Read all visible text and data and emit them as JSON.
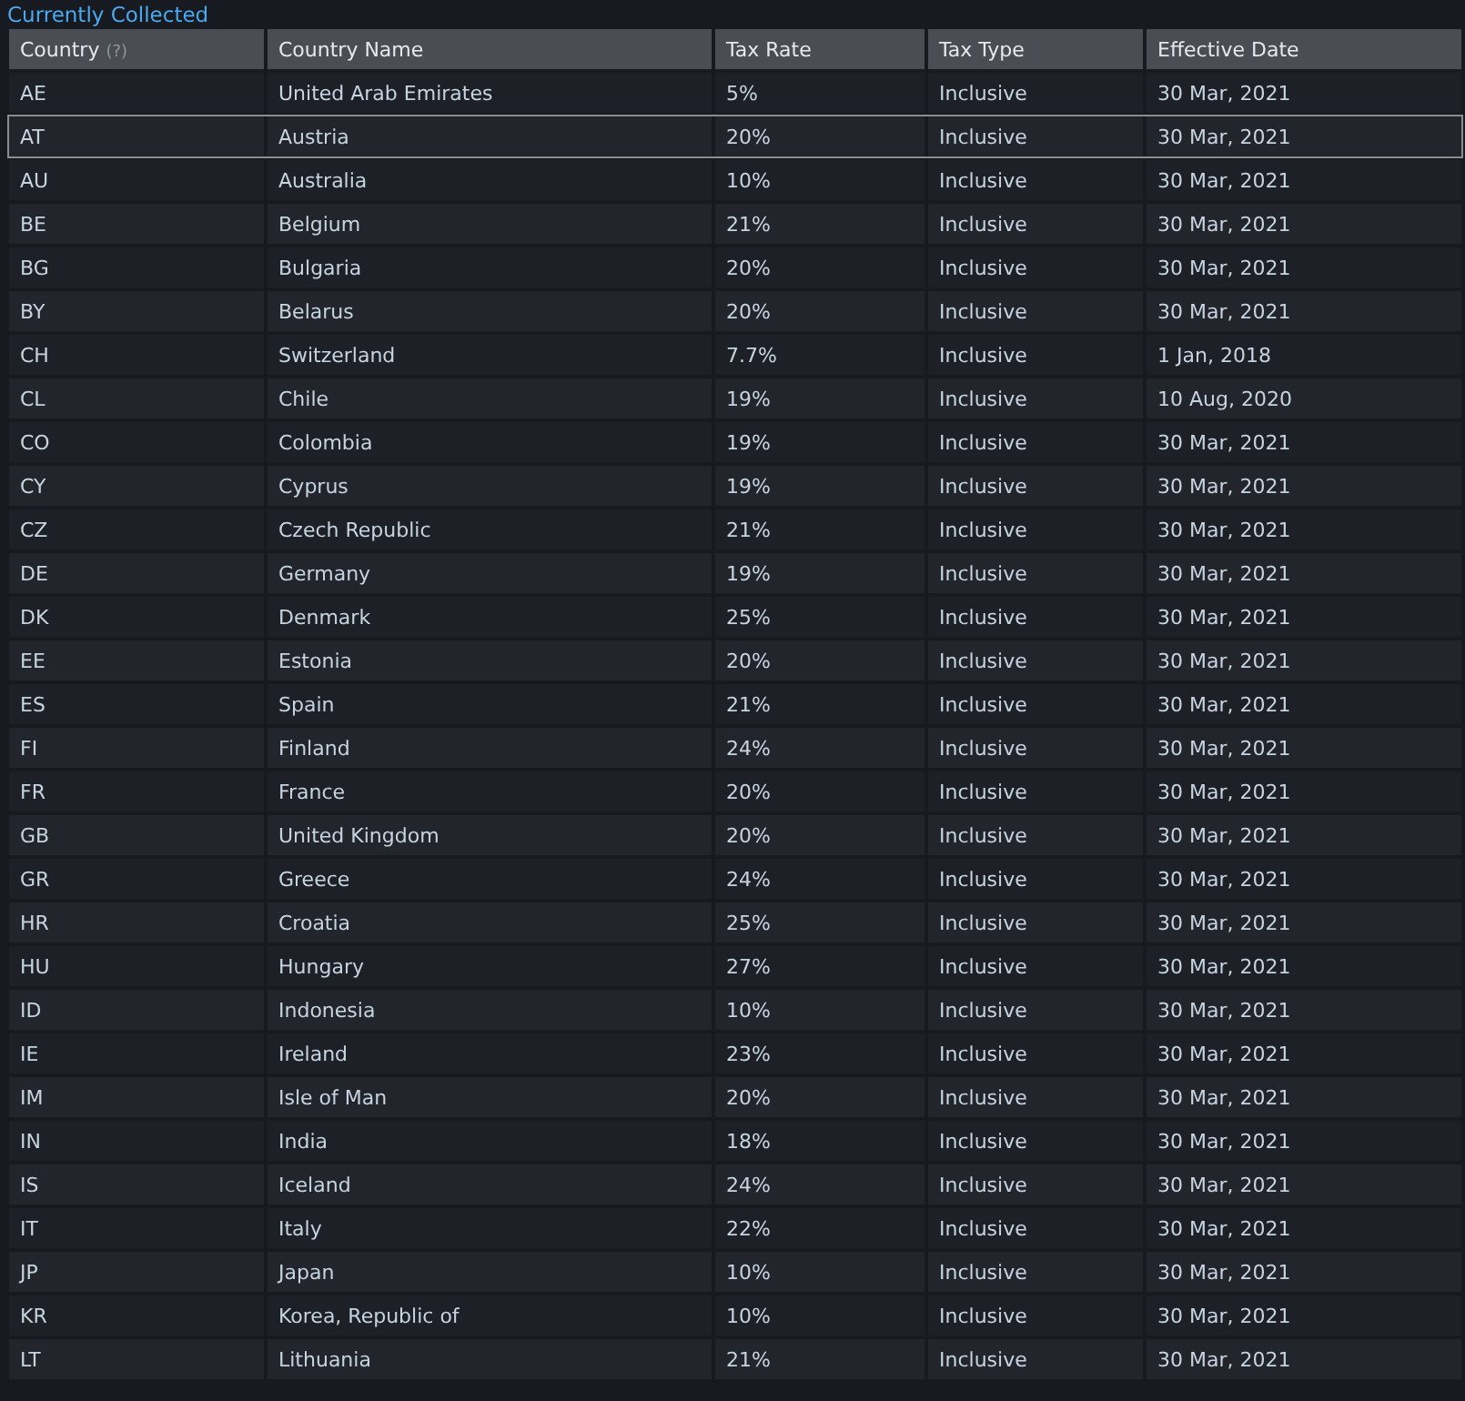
{
  "title": "Currently Collected",
  "table": {
    "columns": [
      {
        "label": "Country",
        "hint": "(?)"
      },
      {
        "label": "Country Name"
      },
      {
        "label": "Tax Rate"
      },
      {
        "label": "Tax Type"
      },
      {
        "label": "Effective Date"
      }
    ],
    "rows": [
      {
        "cells": [
          "AE",
          "United Arab Emirates",
          "5%",
          "Inclusive",
          "30 Mar, 2021"
        ],
        "selected": false
      },
      {
        "cells": [
          "AT",
          "Austria",
          "20%",
          "Inclusive",
          "30 Mar, 2021"
        ],
        "selected": true
      },
      {
        "cells": [
          "AU",
          "Australia",
          "10%",
          "Inclusive",
          "30 Mar, 2021"
        ],
        "selected": false
      },
      {
        "cells": [
          "BE",
          "Belgium",
          "21%",
          "Inclusive",
          "30 Mar, 2021"
        ],
        "selected": false
      },
      {
        "cells": [
          "BG",
          "Bulgaria",
          "20%",
          "Inclusive",
          "30 Mar, 2021"
        ],
        "selected": false
      },
      {
        "cells": [
          "BY",
          "Belarus",
          "20%",
          "Inclusive",
          "30 Mar, 2021"
        ],
        "selected": false
      },
      {
        "cells": [
          "CH",
          "Switzerland",
          "7.7%",
          "Inclusive",
          "1 Jan, 2018"
        ],
        "selected": false
      },
      {
        "cells": [
          "CL",
          "Chile",
          "19%",
          "Inclusive",
          "10 Aug, 2020"
        ],
        "selected": false
      },
      {
        "cells": [
          "CO",
          "Colombia",
          "19%",
          "Inclusive",
          "30 Mar, 2021"
        ],
        "selected": false
      },
      {
        "cells": [
          "CY",
          "Cyprus",
          "19%",
          "Inclusive",
          "30 Mar, 2021"
        ],
        "selected": false
      },
      {
        "cells": [
          "CZ",
          "Czech Republic",
          "21%",
          "Inclusive",
          "30 Mar, 2021"
        ],
        "selected": false
      },
      {
        "cells": [
          "DE",
          "Germany",
          "19%",
          "Inclusive",
          "30 Mar, 2021"
        ],
        "selected": false
      },
      {
        "cells": [
          "DK",
          "Denmark",
          "25%",
          "Inclusive",
          "30 Mar, 2021"
        ],
        "selected": false
      },
      {
        "cells": [
          "EE",
          "Estonia",
          "20%",
          "Inclusive",
          "30 Mar, 2021"
        ],
        "selected": false
      },
      {
        "cells": [
          "ES",
          "Spain",
          "21%",
          "Inclusive",
          "30 Mar, 2021"
        ],
        "selected": false
      },
      {
        "cells": [
          "FI",
          "Finland",
          "24%",
          "Inclusive",
          "30 Mar, 2021"
        ],
        "selected": false
      },
      {
        "cells": [
          "FR",
          "France",
          "20%",
          "Inclusive",
          "30 Mar, 2021"
        ],
        "selected": false
      },
      {
        "cells": [
          "GB",
          "United Kingdom",
          "20%",
          "Inclusive",
          "30 Mar, 2021"
        ],
        "selected": false
      },
      {
        "cells": [
          "GR",
          "Greece",
          "24%",
          "Inclusive",
          "30 Mar, 2021"
        ],
        "selected": false
      },
      {
        "cells": [
          "HR",
          "Croatia",
          "25%",
          "Inclusive",
          "30 Mar, 2021"
        ],
        "selected": false
      },
      {
        "cells": [
          "HU",
          "Hungary",
          "27%",
          "Inclusive",
          "30 Mar, 2021"
        ],
        "selected": false
      },
      {
        "cells": [
          "ID",
          "Indonesia",
          "10%",
          "Inclusive",
          "30 Mar, 2021"
        ],
        "selected": false
      },
      {
        "cells": [
          "IE",
          "Ireland",
          "23%",
          "Inclusive",
          "30 Mar, 2021"
        ],
        "selected": false
      },
      {
        "cells": [
          "IM",
          "Isle of Man",
          "20%",
          "Inclusive",
          "30 Mar, 2021"
        ],
        "selected": false
      },
      {
        "cells": [
          "IN",
          "India",
          "18%",
          "Inclusive",
          "30 Mar, 2021"
        ],
        "selected": false
      },
      {
        "cells": [
          "IS",
          "Iceland",
          "24%",
          "Inclusive",
          "30 Mar, 2021"
        ],
        "selected": false
      },
      {
        "cells": [
          "IT",
          "Italy",
          "22%",
          "Inclusive",
          "30 Mar, 2021"
        ],
        "selected": false
      },
      {
        "cells": [
          "JP",
          "Japan",
          "10%",
          "Inclusive",
          "30 Mar, 2021"
        ],
        "selected": false
      },
      {
        "cells": [
          "KR",
          "Korea, Republic of",
          "10%",
          "Inclusive",
          "30 Mar, 2021"
        ],
        "selected": false
      },
      {
        "cells": [
          "LT",
          "Lithuania",
          "21%",
          "Inclusive",
          "30 Mar, 2021"
        ],
        "selected": false
      }
    ]
  }
}
